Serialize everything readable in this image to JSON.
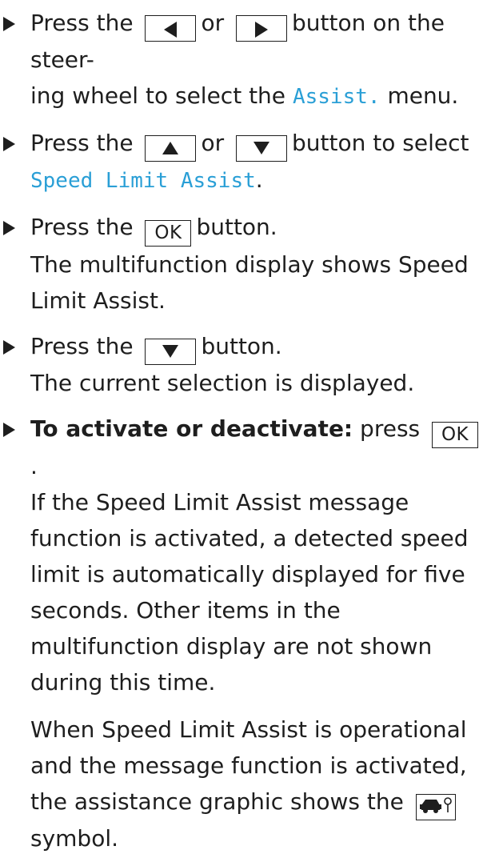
{
  "colors": {
    "text": "#1e1e1e",
    "menu_text": "#2a9fd6",
    "background": "#ffffff"
  },
  "steps": {
    "s1": {
      "pre": "Press the",
      "left_key_icon": "left-arrow-icon",
      "or": "or",
      "right_key_icon": "right-arrow-icon",
      "post_a": "button on the steer-",
      "post_b": "ing wheel to select the",
      "menu": "Assist.",
      "post_c": "menu."
    },
    "s2": {
      "pre": "Press the",
      "up_key_icon": "up-arrow-icon",
      "or": "or",
      "down_key_icon": "down-arrow-icon",
      "post_a": "button to select",
      "menu": "Speed Limit Assist",
      "post_b": "."
    },
    "s3": {
      "pre": "Press the",
      "key": "OK",
      "post": "button.",
      "result": "The multifunction display shows Speed Limit Assist."
    },
    "s4": {
      "pre": "Press the",
      "down_key_icon": "down-arrow-icon",
      "post": "button.",
      "result": "The current selection is displayed."
    },
    "s5": {
      "bold": "To activate or deactivate:",
      "pre": "press",
      "key": "OK",
      "post": ".",
      "para1": "If the Speed Limit Assist message function is activated, a detected speed limit is auto­matically displayed for five seconds. Other items in the multifunction display are not shown during this time.",
      "para2_a": "When Speed Limit Assist is operational and the message function is activated, the assistance graphic shows the",
      "symbol_icon": "car-assist-symbol-icon",
      "para2_b": "sym­bol."
    }
  }
}
